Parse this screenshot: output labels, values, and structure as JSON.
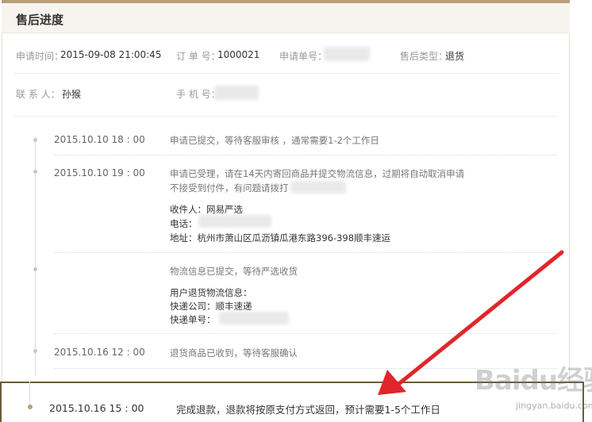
{
  "header": {
    "title": "售后进度"
  },
  "meta": {
    "apply_time_label": "申请时间：",
    "apply_time_value": "2015-09-08  21:00:45",
    "order_no_label": "订 单 号：",
    "order_no_value": "1000021",
    "request_no_label": "申请单号：",
    "type_label": "售后类型：",
    "type_value": "退货",
    "contact_label": "联 系 人：",
    "contact_value": "孙猴",
    "phone_label": "手 机 号："
  },
  "timeline": [
    {
      "time": "2015.10.10   18 : 00",
      "lines": [
        "申请已提交，等待客服审核 ，通常需要1-2个工作日"
      ]
    },
    {
      "time": "2015.10.10   19 : 00",
      "lines": [
        "申请已受理，请在14天内寄回商品并提交物流信息，过期将自动取消申请",
        "不接受到付件，有问题请拨打"
      ],
      "details": [
        "收件人：网易严选",
        "电话：",
        "地址：杭州市萧山区瓜沥镇瓜港东路396-398顺丰速运"
      ]
    },
    {
      "time": "",
      "lines": [
        "物流信息已提交，等待严选收货"
      ],
      "details": [
        "用户退货物流信息：",
        "快递公司：顺丰速递",
        "快递单号："
      ]
    },
    {
      "time": "2015.10.16   12 : 00",
      "lines": [
        "退货商品已收到，等待客服确认"
      ]
    }
  ],
  "highlight": {
    "time": "2015.10.16   15 : 00",
    "text": "完成退款，退款将按原支付方式返回，预计需要1-5个工作日"
  },
  "watermark": {
    "logo": "Baidu经验",
    "url": "jingyan.baidu.com"
  },
  "colors": {
    "accent": "#b89e79",
    "arrow": "#e0262b",
    "highlight_border": "#6b5a3d"
  }
}
